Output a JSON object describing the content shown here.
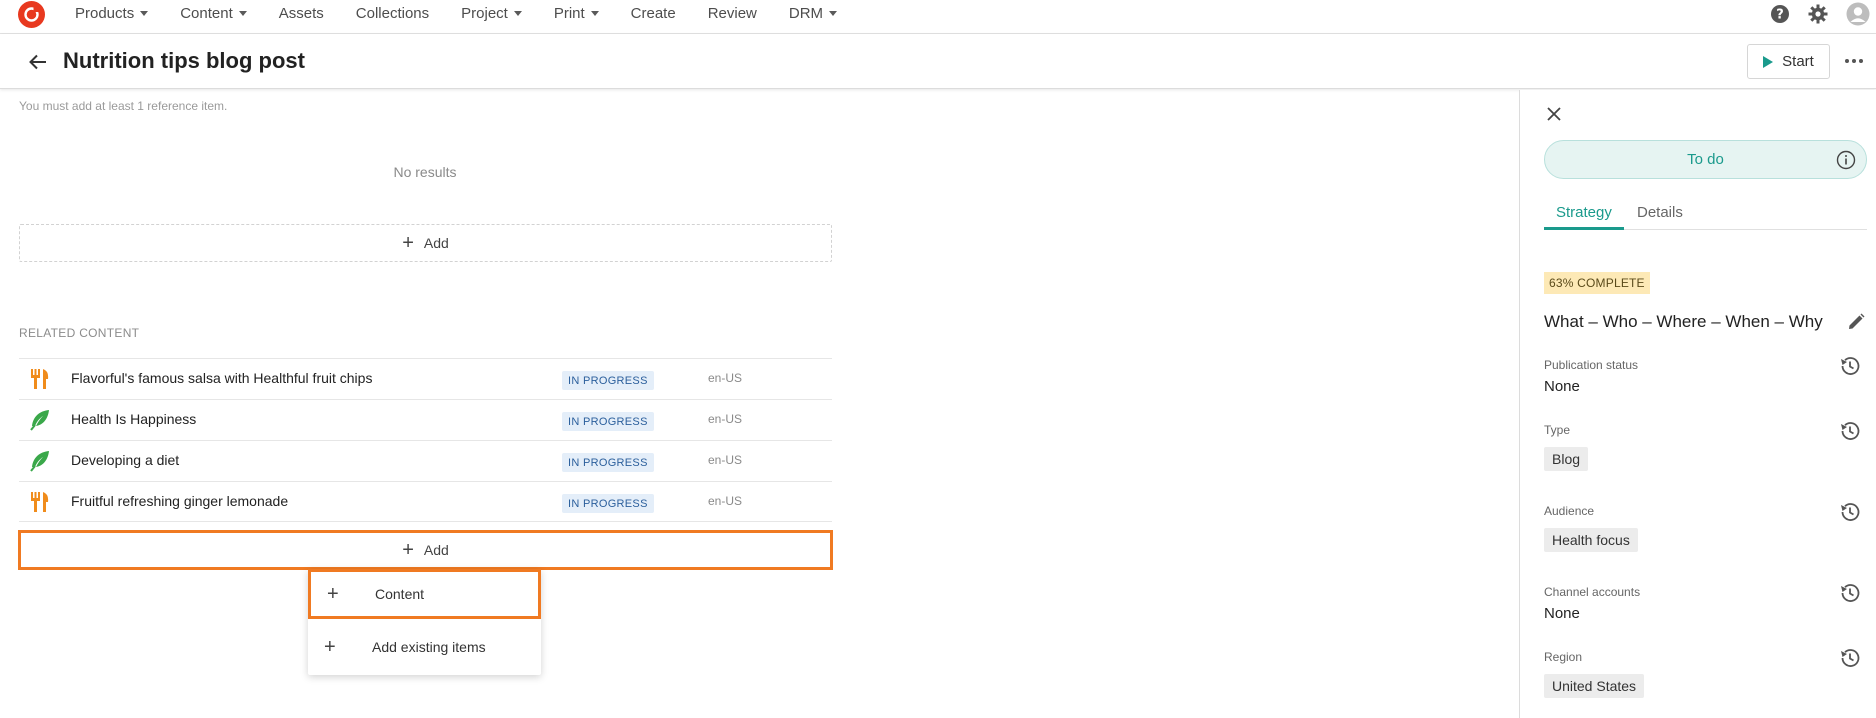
{
  "nav": {
    "items": [
      {
        "label": "Products",
        "has_caret": true
      },
      {
        "label": "Content",
        "has_caret": true
      },
      {
        "label": "Assets",
        "has_caret": false
      },
      {
        "label": "Collections",
        "has_caret": false
      },
      {
        "label": "Project",
        "has_caret": true
      },
      {
        "label": "Print",
        "has_caret": true
      },
      {
        "label": "Create",
        "has_caret": false
      },
      {
        "label": "Review",
        "has_caret": false
      },
      {
        "label": "DRM",
        "has_caret": true
      }
    ],
    "right_icons": [
      "help-icon",
      "gear-icon",
      "user-avatar-icon"
    ]
  },
  "header": {
    "title": "Nutrition tips blog post",
    "start_label": "Start"
  },
  "main": {
    "hint": "You must add at least 1 reference item.",
    "no_results": "No results",
    "add_label": "Add",
    "related_label": "RELATED CONTENT",
    "related_items": [
      {
        "title": "Flavorful's famous salsa with Healthful fruit chips",
        "status": "IN PROGRESS",
        "locale": "en-US",
        "icon": "fork-knife-icon"
      },
      {
        "title": "Health Is Happiness",
        "status": "IN PROGRESS",
        "locale": "en-US",
        "icon": "feather-icon"
      },
      {
        "title": "Developing a diet",
        "status": "IN PROGRESS",
        "locale": "en-US",
        "icon": "feather-icon"
      },
      {
        "title": "Fruitful refreshing ginger lemonade",
        "status": "IN PROGRESS",
        "locale": "en-US",
        "icon": "fork-knife-icon"
      }
    ],
    "add_menu": [
      {
        "label": "Content"
      },
      {
        "label": "Add existing items"
      }
    ]
  },
  "panel": {
    "state": "To do",
    "tabs": [
      "Strategy",
      "Details"
    ],
    "complete": "63% COMPLETE",
    "heading": "What – Who – Where – When – Why",
    "fields": {
      "publication_status": {
        "label": "Publication status",
        "value": "None"
      },
      "type": {
        "label": "Type",
        "value": "Blog"
      },
      "audience": {
        "label": "Audience",
        "value": "Health focus"
      },
      "channel_accounts": {
        "label": "Channel accounts",
        "value": "None"
      },
      "region": {
        "label": "Region",
        "value": "United States"
      }
    }
  },
  "colors": {
    "accent": "#1a9a8c",
    "highlight": "#f07a22",
    "logo": "#e8391f",
    "status_badge_bg": "#e4eef9",
    "complete_badge_bg": "#fde9b6"
  }
}
